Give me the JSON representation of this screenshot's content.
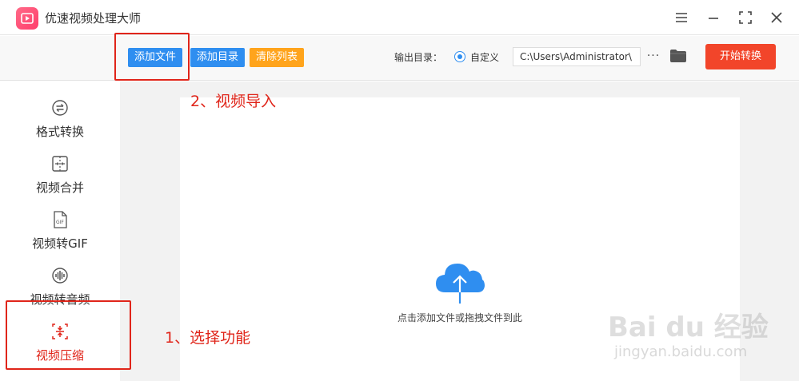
{
  "app": {
    "title": "优速视频处理大师"
  },
  "toolbar": {
    "add_file": "添加文件",
    "add_dir": "添加目录",
    "clear_list": "清除列表",
    "output_label": "输出目录：",
    "custom_label": "自定义",
    "output_path": "C:\\Users\\Administrator\\",
    "more": "···",
    "start": "开始转换"
  },
  "sidebar": {
    "items": [
      {
        "label": "格式转换",
        "icon": "format-convert-icon"
      },
      {
        "label": "视频合并",
        "icon": "merge-icon"
      },
      {
        "label": "视频转GIF",
        "icon": "gif-icon"
      },
      {
        "label": "视频转音频",
        "icon": "audio-icon"
      },
      {
        "label": "视频压缩",
        "icon": "compress-icon",
        "active": true
      }
    ]
  },
  "main": {
    "drop_hint": "点击添加文件或拖拽文件到此"
  },
  "annotations": {
    "step1": "1、选择功能",
    "step2": "2、视频导入"
  },
  "watermark": {
    "logo": "Bai du 经验",
    "url": "jingyan.baidu.com"
  },
  "colors": {
    "accent_blue": "#2f8ef0",
    "orange": "#ffa41c",
    "start_red": "#f2452a",
    "annotation_red": "#e0251a"
  }
}
